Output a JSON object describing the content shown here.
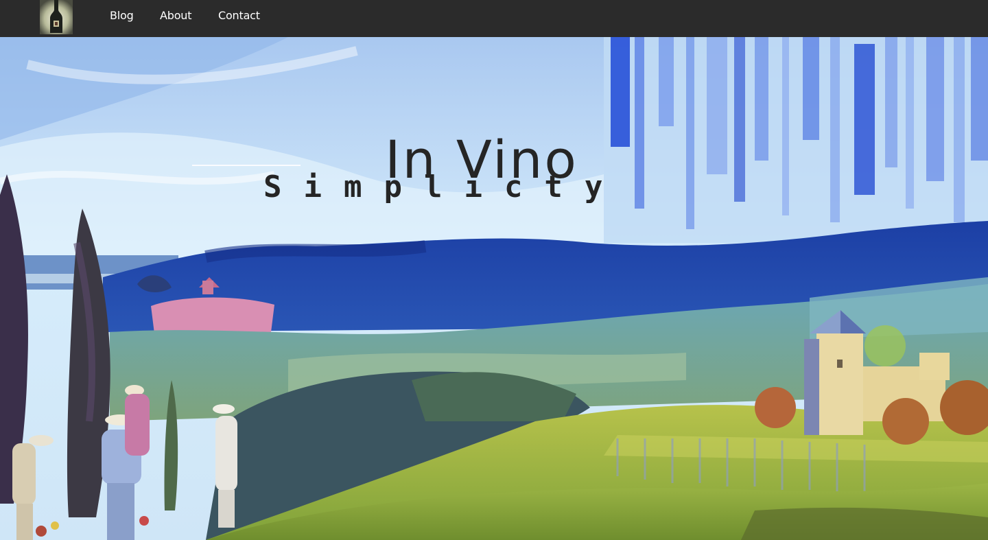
{
  "nav": {
    "logo": "wine-bottle-logo",
    "links": [
      {
        "label": "Blog"
      },
      {
        "label": "About"
      },
      {
        "label": "Contact"
      }
    ]
  },
  "hero": {
    "title": "In Vino",
    "subtitle": "Simplicty",
    "image": "impressionist-vineyard-painting"
  },
  "colors": {
    "nav_bg": "#2b2b2b",
    "nav_text": "#ffffff",
    "heading": "#252525"
  }
}
